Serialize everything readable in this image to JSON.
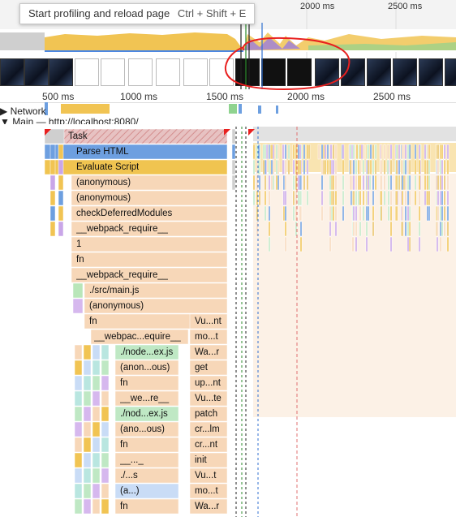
{
  "tooltip": {
    "label": "Start profiling and reload page",
    "shortcut": "Ctrl + Shift + E"
  },
  "overview_ticks": [
    "2000 ms",
    "2500 ms"
  ],
  "ruler_ticks": [
    "500 ms",
    "1000 ms",
    "1500 ms",
    "2000 ms",
    "2500 ms"
  ],
  "tracks": {
    "network": "Network",
    "main": "Main — http://localhost:8080/"
  },
  "flame": {
    "task": "Task",
    "col1": [
      "Parse HTML",
      "Evaluate Script",
      "(anonymous)",
      "(anonymous)",
      "checkDeferredModules",
      "__webpack_require__",
      "1",
      "fn",
      "__webpack_require__"
    ],
    "col2": [
      "./src/main.js",
      "(anonymous)",
      "fn"
    ],
    "col3": [
      "__webpac...equire__"
    ],
    "col4": [
      "./node...ex.js",
      "(anon...ous)",
      "fn",
      "__we...re__",
      "./nod...ex.js",
      "(ano...ous)",
      "fn",
      "__..._",
      "./...s",
      "(a...)",
      "fn"
    ],
    "right": [
      "Vu...nt",
      "mo...t",
      "Wa...r",
      "get",
      "up...nt",
      "Vu...te",
      "patch",
      "cr...lm",
      "cr...nt",
      "init",
      "Vu...t",
      "mo...t",
      "Wa...r"
    ]
  },
  "colors": {
    "parse_html": "#6d9fe0",
    "evaluate_script": "#f0c450",
    "js_light": "#f7d7b8",
    "annotation": "#e8201f"
  }
}
